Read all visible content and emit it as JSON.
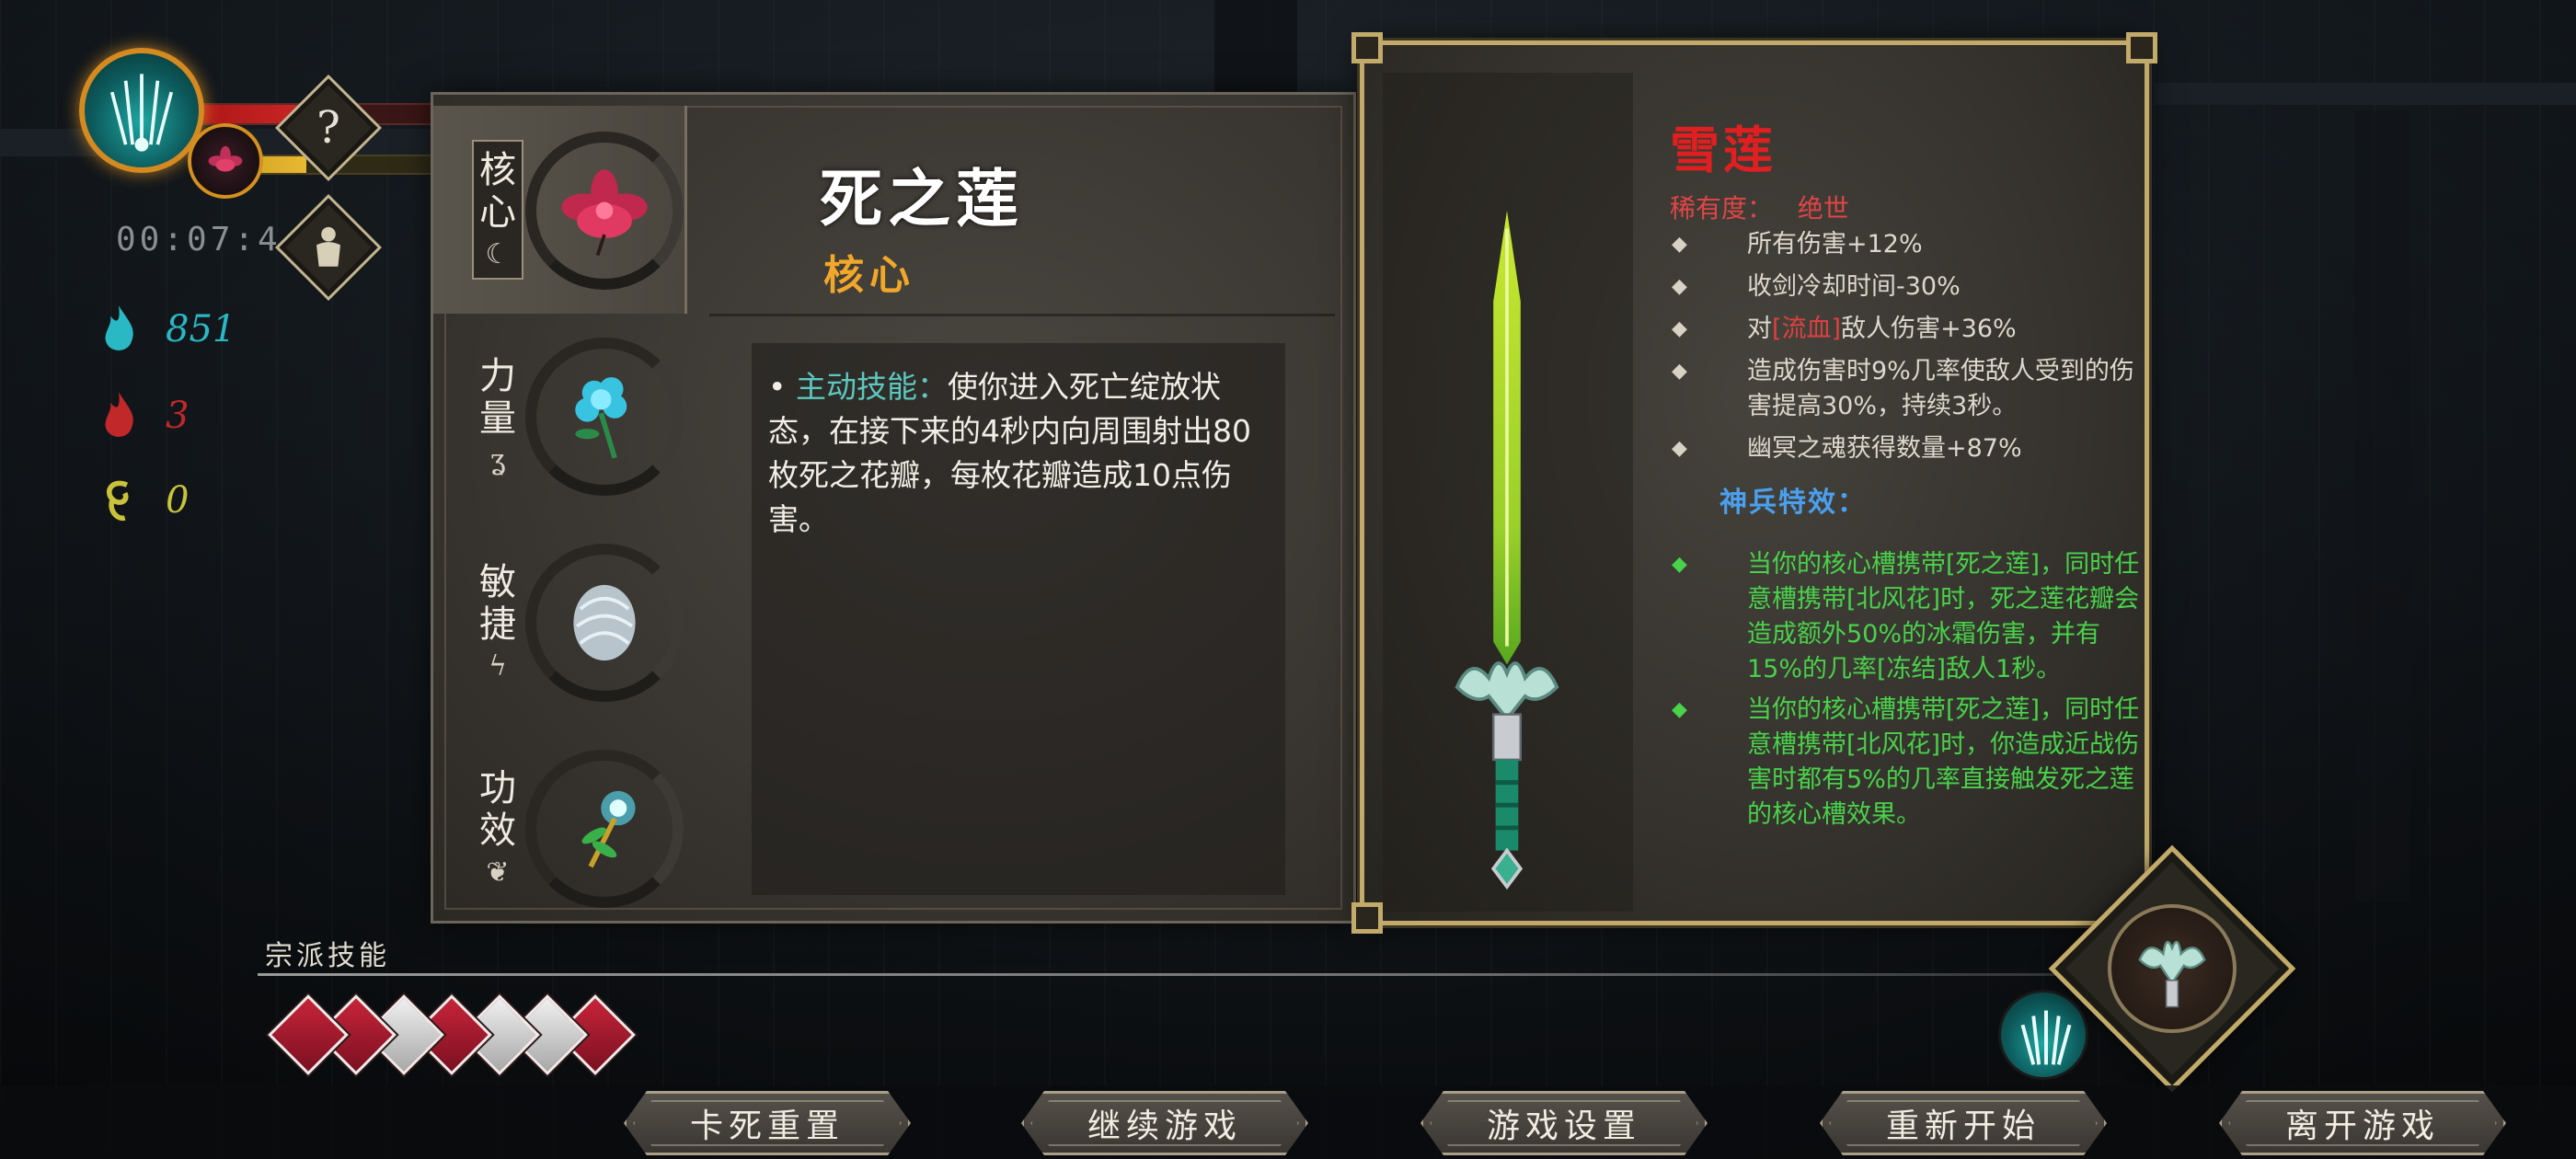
{
  "hud": {
    "timer": "00:07:4",
    "help_glyph": "?",
    "stats": [
      {
        "name": "soul-cyan",
        "value": "851",
        "color": "#2ab8c4"
      },
      {
        "name": "blood-red",
        "value": "3",
        "color": "#c0282a"
      },
      {
        "name": "spirit-yellow",
        "value": "0",
        "color": "#c9c23a"
      }
    ],
    "hp_fraction": 0.55,
    "mp_fraction": 0.45
  },
  "tabs": [
    {
      "label": [
        "核",
        "心"
      ],
      "glyph": "☾",
      "active": true,
      "item_icon": "red-lotus-icon"
    },
    {
      "label": [
        "力",
        "量"
      ],
      "glyph": "ʓ",
      "active": false,
      "item_icon": "blue-flower-icon"
    },
    {
      "label": [
        "敏",
        "捷"
      ],
      "glyph": "ϟ",
      "active": false,
      "item_icon": "white-orb-icon"
    },
    {
      "label": [
        "功",
        "效"
      ],
      "glyph": "❦",
      "active": false,
      "item_icon": "glowing-flower-icon"
    }
  ],
  "item": {
    "title": "死之莲",
    "type": "核心",
    "desc_bullet": "•",
    "desc_keyword": "主动技能：",
    "desc_text": "使你进入死亡绽放状态，在接下来的4秒内向周围射出80枚死之花瓣，每枚花瓣造成10点伤害。"
  },
  "weapon": {
    "name": "雪莲",
    "rarity_label": "稀有度：",
    "rarity_value": "绝世",
    "stats": [
      {
        "text": "所有伤害+12%"
      },
      {
        "text": "收剑冷却时间-30%"
      },
      {
        "pre": "对",
        "bleed": "[流血]",
        "post": "敌人伤害+36%"
      },
      {
        "text": "造成伤害时9%几率使敌人受到的伤害提高30%，持续3秒。"
      },
      {
        "text": "幽冥之魂获得数量+87%"
      }
    ],
    "special_title": "神兵特效：",
    "effects": [
      "当你的核心槽携带[死之莲]，同时任意槽携带[北风花]时，死之莲花瓣会造成额外50%的冰霜伤害，并有15%的几率[冻结]敌人1秒。",
      "当你的核心槽携带[死之莲]，同时任意槽携带[北风花]时，你造成近战伤害时都有5%的几率直接触发死之莲的核心槽效果。"
    ]
  },
  "bottom": {
    "sect_label": "宗派技能",
    "skill_colors": [
      "#c8243a",
      "#c8243a",
      "#e0e0e0",
      "#c8243a",
      "#e0e0e0",
      "#e0e0e0",
      "#c8243a"
    ],
    "menu": [
      "卡死重置",
      "继续游戏",
      "游戏设置",
      "重新开始",
      "离开游戏"
    ]
  },
  "colors": {
    "accent_gold": "#c2aa6a",
    "rarity_red": "#e04545",
    "effect_green": "#49d24a",
    "keyword_cyan": "#5cc8c0",
    "special_blue": "#4aa0ee"
  }
}
